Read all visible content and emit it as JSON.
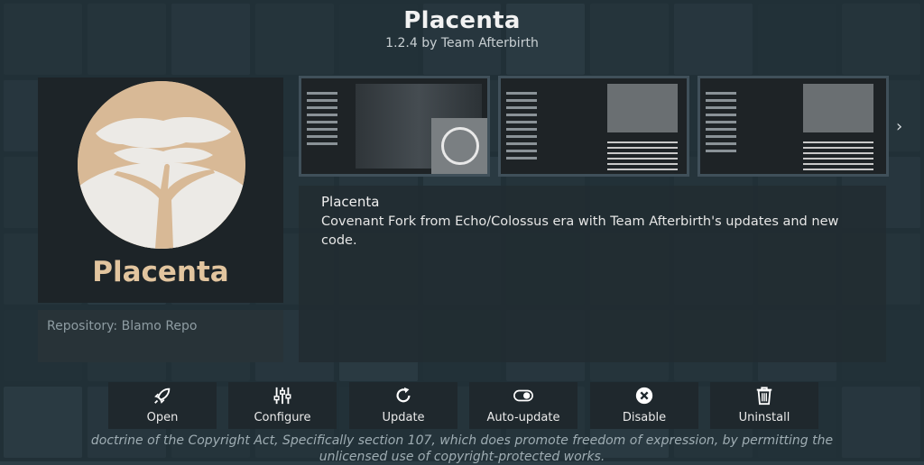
{
  "addon": {
    "title": "Placenta",
    "subtitle": "1.2.4 by Team Afterbirth",
    "logo_text": "Placenta",
    "repository": "Repository: Blamo Repo",
    "description_title": "Placenta",
    "description": "Covenant Fork from Echo/Colossus era with Team Afterbirth's updates and new code."
  },
  "actions": [
    {
      "label": "Open",
      "icon": "rocket-icon"
    },
    {
      "label": "Configure",
      "icon": "sliders-icon"
    },
    {
      "label": "Update",
      "icon": "refresh-icon"
    },
    {
      "label": "Auto-update",
      "icon": "toggle-icon"
    },
    {
      "label": "Disable",
      "icon": "close-circle-icon"
    },
    {
      "label": "Uninstall",
      "icon": "trash-icon"
    }
  ],
  "ticker": {
    "line1": "doctrine of the Copyright Act, Specifically section 107, which does promote freedom of expression, by permitting the",
    "line2": "unlicensed use of copyright-protected works."
  },
  "colors": {
    "logo_tan": "#d8b996",
    "logo_text": "#e2c59f",
    "panel_dark": "#1d2428",
    "button_bg": "#1f282d"
  }
}
